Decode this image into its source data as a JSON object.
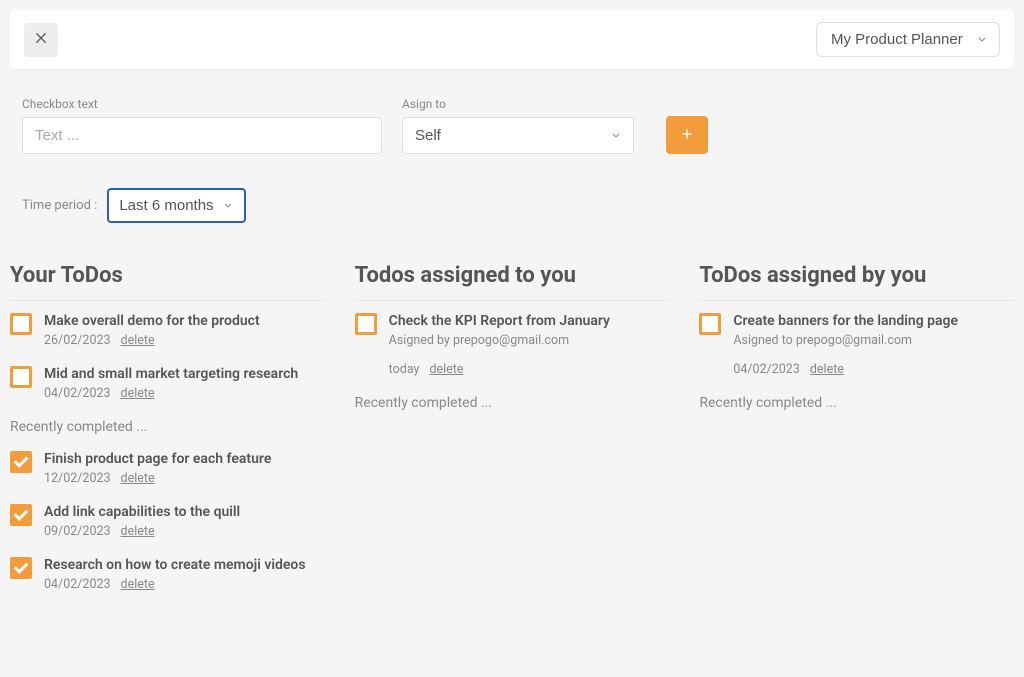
{
  "header": {
    "planner_selected": "My Product Planner"
  },
  "form": {
    "checkbox_label": "Checkbox text",
    "checkbox_placeholder": "Text ...",
    "assign_label": "Asign to",
    "assign_selected": "Self"
  },
  "time": {
    "label": "Time period :",
    "selected": "Last 6 months"
  },
  "columns": {
    "your": {
      "title": "Your ToDos",
      "items": [
        {
          "title": "Make overall demo for the product",
          "date": "26/02/2023",
          "delete": "delete"
        },
        {
          "title": "Mid and small market targeting research",
          "date": "04/02/2023",
          "delete": "delete"
        }
      ],
      "recently": "Recently completed ...",
      "completed": [
        {
          "title": "Finish product page for each feature",
          "date": "12/02/2023",
          "delete": "delete"
        },
        {
          "title": "Add link capabilities to the quill",
          "date": "09/02/2023",
          "delete": "delete"
        },
        {
          "title": "Research on how to create memoji videos",
          "date": "04/02/2023",
          "delete": "delete"
        }
      ]
    },
    "to_you": {
      "title": "Todos assigned to you",
      "items": [
        {
          "title": "Check the KPI Report from January",
          "assigned": "Asigned by prepogo@gmail.com",
          "date": "today",
          "delete": "delete"
        }
      ],
      "recently": "Recently completed ..."
    },
    "by_you": {
      "title": "ToDos assigned by you",
      "items": [
        {
          "title": "Create banners for the landing page",
          "assigned": "Asigned to prepogo@gmail.com",
          "date": "04/02/2023",
          "delete": "delete"
        }
      ],
      "recently": "Recently completed ..."
    }
  }
}
